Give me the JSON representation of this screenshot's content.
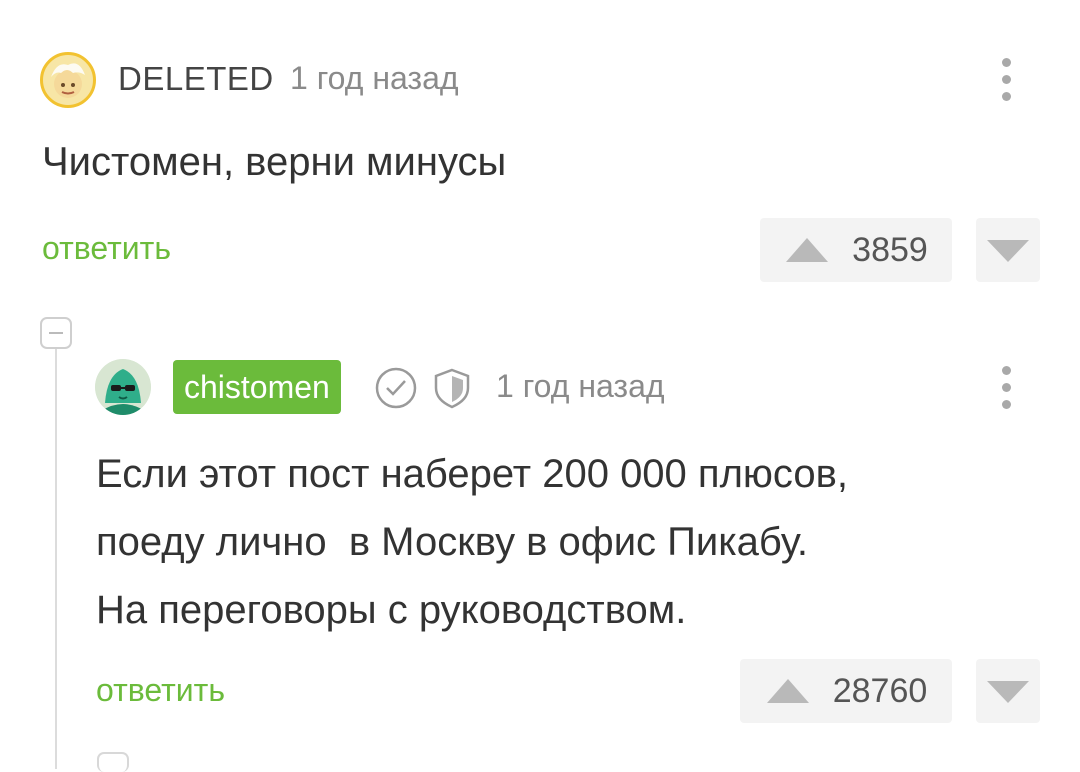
{
  "comments": [
    {
      "author": "DELETED",
      "time": "1 год назад",
      "body": "Чистомен, верни минусы",
      "reply_label": "ответить",
      "score": "3859"
    },
    {
      "author": "chistomen",
      "time": "1 год назад",
      "body_lines": [
        "Если этот пост наберет 200 000 плюсов,",
        "поеду лично  в Москву в офис Пикабу.",
        "На переговоры с руководством."
      ],
      "reply_label": "ответить",
      "score": "28760"
    }
  ],
  "colors": {
    "accent_green": "#6bbb3b",
    "muted_text": "#8a8a8a",
    "vote_bg": "#f3f3f3",
    "deleted_avatar_ring": "#f2c230"
  },
  "icons": [
    "more-vert-icon",
    "upvote-icon",
    "downvote-icon",
    "collapse-icon",
    "verified-check-icon",
    "shield-icon"
  ]
}
